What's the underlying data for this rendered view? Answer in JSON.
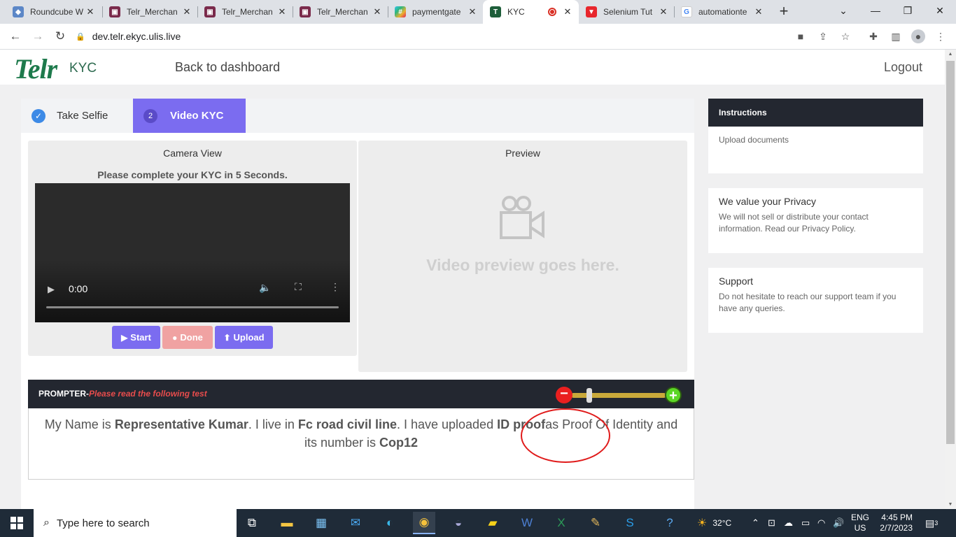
{
  "browser": {
    "tabs": [
      {
        "title": "Roundcube W",
        "icon": "roundcube-icon",
        "color": "#5c87c7"
      },
      {
        "title": "Telr_Merchan",
        "icon": "telr-favicon-icon",
        "color": "#7a2a4b"
      },
      {
        "title": "Telr_Merchan",
        "icon": "telr-favicon-icon",
        "color": "#7a2a4b"
      },
      {
        "title": "Telr_Merchan",
        "icon": "telr-favicon-icon",
        "color": "#7a2a4b"
      },
      {
        "title": "paymentgate",
        "icon": "slack-icon",
        "color": "#e01e5a"
      },
      {
        "title": "KYC",
        "icon": "telr-kyc-icon",
        "color": "#1e5e3a"
      },
      {
        "title": "Selenium Tut",
        "icon": "selenium-tutorial-icon",
        "color": "#e8262c"
      },
      {
        "title": "automationte",
        "icon": "google-icon",
        "color": "#4285f4"
      }
    ],
    "url": "dev.telr.ekyc.ulis.live"
  },
  "site": {
    "logo": "Telr",
    "logo_suffix": "KYC",
    "back_link": "Back to dashboard",
    "logout": "Logout"
  },
  "steps": {
    "step1_label": "Take Selfie",
    "step2_number": "2",
    "step2_label": "Video KYC"
  },
  "camera": {
    "title": "Camera View",
    "message": "Please complete your KYC in 5 Seconds.",
    "time": "0:00"
  },
  "buttons": {
    "start": "Start",
    "done": "Done",
    "upload": "Upload"
  },
  "preview": {
    "title": "Preview",
    "placeholder": "Video preview goes here."
  },
  "prompter": {
    "label": "PROMPTER-",
    "sublabel": "Please read the following test",
    "t1": "My Name is ",
    "name": "Representative Kumar",
    "t2": ". I live in ",
    "address": "Fc road civil line",
    "t3": ". I have uploaded ",
    "doc": "ID proof",
    "t4": "as Proof Of Identity and its number is ",
    "number": "Cop12"
  },
  "sidebar": {
    "instructions_title": "Instructions",
    "instructions_body": "Upload documents",
    "privacy_title": "We value your Privacy",
    "privacy_body": "We will not sell or distribute your contact information. Read our Privacy Policy.",
    "support_title": "Support",
    "support_body": "Do not hesitate to reach our support team if you have any queries."
  },
  "taskbar": {
    "search_placeholder": "Type here to search",
    "weather": "32°C",
    "lang1": "ENG",
    "lang2": "US",
    "time": "4:45 PM",
    "date": "2/7/2023",
    "notifications": "3"
  },
  "colors": {
    "brand_green": "#1e7a4c",
    "accent_purple": "#7b6cf0",
    "annotation_red": "#e01b1b"
  }
}
